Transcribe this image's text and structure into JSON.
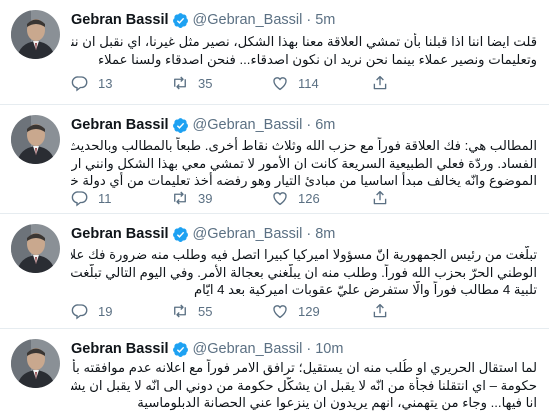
{
  "tweets": [
    {
      "name": "Gebran Bassil",
      "handle": "@Gebran_Bassil",
      "time": "5m",
      "lines": [
        "قلت ايضا اننا اذا قبلنا بأن تمشي العلاقة معنا بهذا الشكل، نصير مثل غيرنا، اي نقبل ان ننفذ اوامر",
        "وتعليمات ونصير عملاء بينما نحن نريد ان نكون اصدقاء... فنحن اصدقاء ولسنا عملاء"
      ],
      "replies": "13",
      "retweets": "35",
      "likes": "114"
    },
    {
      "name": "Gebran Bassil",
      "handle": "@Gebran_Bassil",
      "time": "6m",
      "lines": [
        "المطالب هي: فك العلاقة فوراً مع حزب الله وثلاث نقاط أخرى. طبعاً بالمطالب وبالحديث كاملا لا كلمة عن",
        "الفساد. وردّة فعلي الطبيعية السريعة كانت ان الأمور لا تمشي معي بهذا الشكل وانني ارفض هذا",
        "الموضوع وانّه يخالف مبدأ اساسيا من مبادئ التيار وهو رفضه أخذ تعليمات من أي دولة خارجية"
      ],
      "replies": "11",
      "retweets": "39",
      "likes": "126"
    },
    {
      "name": "Gebran Bassil",
      "handle": "@Gebran_Bassil",
      "time": "8m",
      "lines": [
        "تبلّغت من رئيس الجمهورية انّ مسؤولا اميركيا كبيرا اتصل فيه وطلب منه ضرورة فك علاقة التيار",
        "الوطني الحرّ بحزب الله فوراً. وطلب منه ان يبلّغني بعجالة الأمر. وفي اليوم التالي تبلّغت مباشرة بضرورة",
        "تلبية 4 مطالب فوراً والّا ستفرض عليّ عقوبات اميركية بعد 4 ايّام"
      ],
      "replies": "19",
      "retweets": "55",
      "likes": "129"
    },
    {
      "name": "Gebran Bassil",
      "handle": "@Gebran_Bassil",
      "time": "10m",
      "lines": [
        "لما استقال الحريري او طُلب منه ان يستقيل؛ ترافق الامر فوراً مع اعلانه عدم موافقته بأن اكون معه بأي",
        "حكومة – اي انتقلنا فجأة من انّه لا يقبل ان يشكّل حكومة من دوني الى انّه لا يقبل ان يشكل حكومة اكون",
        "انا فيها... وجاء من يتهمني، انهم يريدون ان ينزعوا عني الحصانة الدبلوماسية"
      ]
    }
  ],
  "colors": {
    "verified": "#1da1f2",
    "muted": "#5b7083",
    "divider": "#e6ecf0"
  },
  "icons": [
    "verified-badge-icon",
    "reply-icon",
    "retweet-icon",
    "like-icon",
    "share-icon"
  ]
}
